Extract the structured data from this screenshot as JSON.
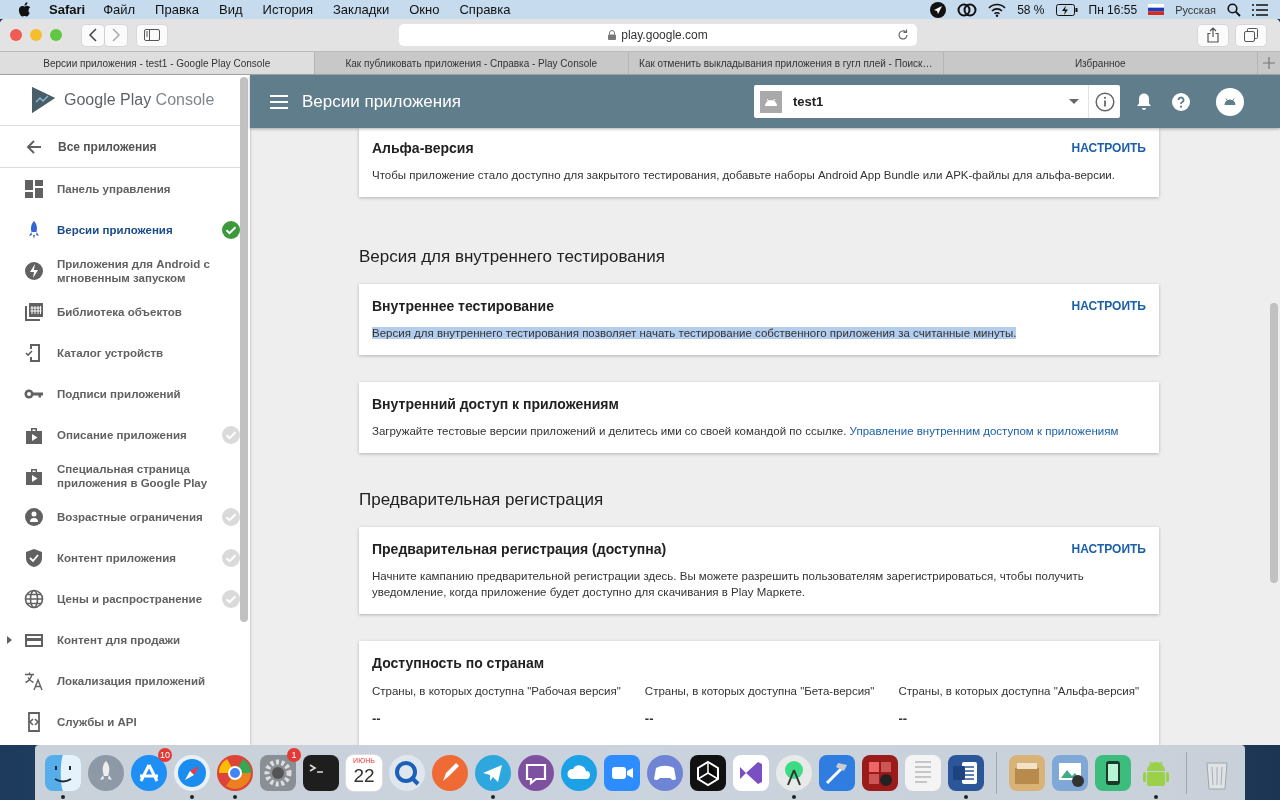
{
  "menu_bar": {
    "app": "Safari",
    "menus": [
      "Файл",
      "Правка",
      "Вид",
      "История",
      "Закладки",
      "Окно",
      "Справка"
    ],
    "battery": "58 %",
    "clock": "Пн 16:55",
    "input_source": "Русская"
  },
  "browser": {
    "address": "play.google.com",
    "tabs": [
      {
        "title": "Версии приложения - test1 - Google Play Console",
        "selected": true
      },
      {
        "title": "Как публиковать приложения - Справка - Play Console",
        "selected": false
      },
      {
        "title": "Как отменить выкладывания приложения в гугл плей - Поиск…",
        "selected": false
      },
      {
        "title": "Избранное",
        "selected": false
      }
    ]
  },
  "console": {
    "brand": {
      "name": "Google Play",
      "product": "Console"
    },
    "sidebar": {
      "back": "Все приложения",
      "items": [
        {
          "label": "Панель управления",
          "selected": false,
          "checkmark": false,
          "complete": false,
          "expandable": false
        },
        {
          "label": "Версии приложения",
          "selected": true,
          "checkmark": true,
          "complete": true,
          "expandable": false
        },
        {
          "label": "Приложения для Android с мгновенным запуском",
          "selected": false,
          "checkmark": false,
          "complete": false,
          "expandable": false
        },
        {
          "label": "Библиотека объектов",
          "selected": false,
          "checkmark": false,
          "complete": false,
          "expandable": false
        },
        {
          "label": "Каталог устройств",
          "selected": false,
          "checkmark": false,
          "complete": false,
          "expandable": false
        },
        {
          "label": "Подписи приложений",
          "selected": false,
          "checkmark": false,
          "complete": false,
          "expandable": false
        },
        {
          "label": "Описание приложения",
          "selected": false,
          "checkmark": true,
          "complete": false,
          "expandable": false
        },
        {
          "label": "Специальная страница приложения в Google Play",
          "selected": false,
          "checkmark": false,
          "complete": false,
          "expandable": false
        },
        {
          "label": "Возрастные ограничения",
          "selected": false,
          "checkmark": true,
          "complete": false,
          "expandable": false
        },
        {
          "label": "Контент приложения",
          "selected": false,
          "checkmark": true,
          "complete": false,
          "expandable": false
        },
        {
          "label": "Цены и распространение",
          "selected": false,
          "checkmark": true,
          "complete": false,
          "expandable": false
        },
        {
          "label": "Контент для продажи",
          "selected": false,
          "checkmark": false,
          "complete": false,
          "expandable": true
        },
        {
          "label": "Локализация приложений",
          "selected": false,
          "checkmark": false,
          "complete": false,
          "expandable": false
        },
        {
          "label": "Службы и API",
          "selected": false,
          "checkmark": false,
          "complete": false,
          "expandable": false
        }
      ]
    },
    "header": {
      "title": "Версии приложения",
      "app_selector": {
        "value": "test1"
      }
    },
    "sections": [
      {
        "kind": "card",
        "title": "Альфа-версия",
        "action": "НАСТРОИТЬ",
        "text": "Чтобы приложение стало доступно для закрытого тестирования, добавьте наборы Android App Bundle или APK-файлы для альфа-версии.",
        "highlighted": false
      },
      {
        "kind": "heading",
        "text": "Версия для внутреннего тестирования"
      },
      {
        "kind": "card",
        "title": "Внутреннее тестирование",
        "action": "НАСТРОИТЬ",
        "text": "Версия для внутреннего тестирования позволяет начать тестирование собственного приложения за считанные минуты.",
        "highlighted": true
      },
      {
        "kind": "card",
        "title": "Внутренний доступ к приложениям",
        "text": "Загружайте тестовые версии приложений и делитесь ими со своей командой по ссылке.",
        "link": "Управление внутренним доступом к приложениям",
        "highlighted": false
      },
      {
        "kind": "heading",
        "text": "Предварительная регистрация"
      },
      {
        "kind": "card",
        "title": "Предварительная регистрация (доступна)",
        "action": "НАСТРОИТЬ",
        "text": "Начните кампанию предварительной регистрации здесь. Вы можете разрешить пользователям зарегистрироваться, чтобы получить уведомление, когда приложение будет доступно для скачивания в Play Маркете.",
        "highlighted": false
      },
      {
        "kind": "columns",
        "title": "Доступность по странам",
        "columns": [
          {
            "label": "Страны, в которых доступна \"Рабочая версия\"",
            "value": "--"
          },
          {
            "label": "Страны, в которых доступна \"Бета-версия\"",
            "value": "--"
          },
          {
            "label": "Страны, в которых доступна \"Альфа-версия\"",
            "value": "--"
          }
        ]
      }
    ]
  },
  "dock": [
    {
      "running": true
    },
    {
      "running": false
    },
    {
      "running": false,
      "badge": "10"
    },
    {
      "running": true
    },
    {
      "running": true
    },
    {
      "running": false,
      "badge": "1"
    },
    {
      "running": false
    },
    {
      "running": false,
      "month": "ИЮНЬ",
      "day": "22"
    },
    {
      "running": false
    },
    {
      "running": false
    },
    {
      "running": true
    },
    {
      "running": false
    },
    {
      "running": false
    },
    {
      "running": false
    },
    {
      "running": false
    },
    {
      "running": false
    },
    {
      "running": false
    },
    {
      "running": true
    },
    {
      "running": false
    },
    {
      "running": false
    },
    {
      "running": false
    },
    {
      "running": true
    },
    {
      "running": false
    },
    {
      "running": false
    },
    {
      "running": false
    },
    {
      "running": true
    },
    {
      "running": false
    }
  ]
}
